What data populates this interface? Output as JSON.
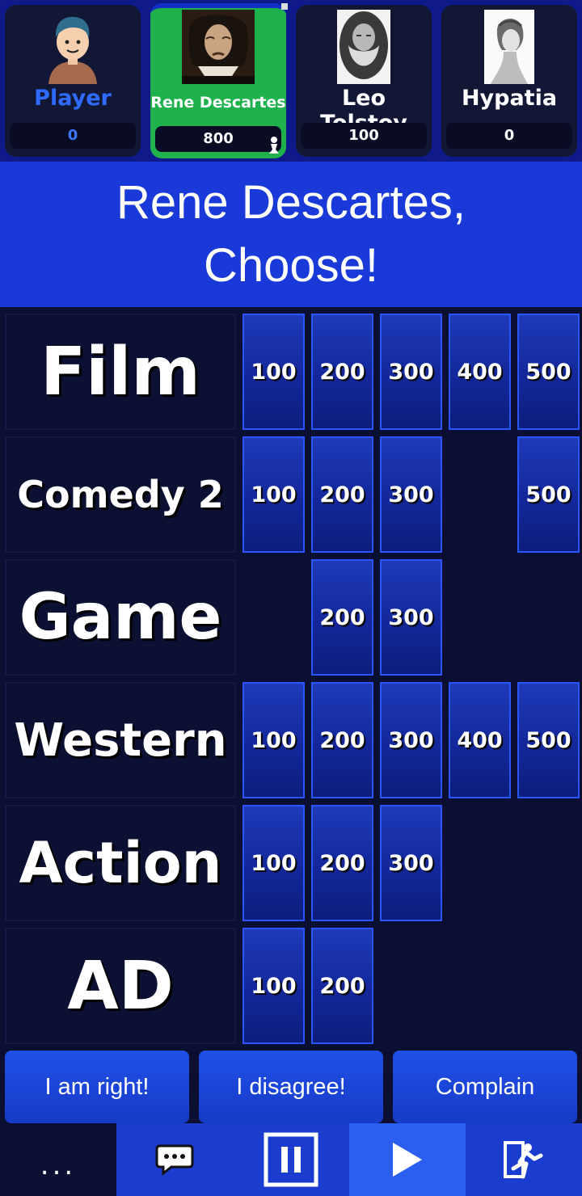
{
  "players": [
    {
      "name": "Player",
      "score": "0",
      "active": false,
      "avatar": "cartoon-person-icon"
    },
    {
      "name": "Rene Descartes",
      "score": "800",
      "active": true,
      "avatar": "descartes-portrait"
    },
    {
      "name": "Leo Tolstoy",
      "score": "100",
      "active": false,
      "avatar": "tolstoy-portrait"
    },
    {
      "name": "Hypatia",
      "score": "0",
      "active": false,
      "avatar": "hypatia-portrait"
    }
  ],
  "banner": {
    "line1": "Rene Descartes,",
    "line2": "Choose!"
  },
  "board": [
    {
      "category": "Film",
      "cells": [
        "100",
        "200",
        "300",
        "400",
        "500"
      ]
    },
    {
      "category": "Comedy 2",
      "cells": [
        "100",
        "200",
        "300",
        "",
        "500"
      ]
    },
    {
      "category": "Game",
      "cells": [
        "",
        "200",
        "300",
        "",
        ""
      ]
    },
    {
      "category": "Western",
      "cells": [
        "100",
        "200",
        "300",
        "400",
        "500"
      ]
    },
    {
      "category": "Action",
      "cells": [
        "100",
        "200",
        "300",
        "",
        ""
      ]
    },
    {
      "category": "AD",
      "cells": [
        "100",
        "200",
        "",
        "",
        ""
      ]
    }
  ],
  "actions": {
    "right": "I am right!",
    "disagree": "I disagree!",
    "complain": "Complain"
  },
  "toolbar": {
    "more": "...",
    "chat_icon": "chat-bubble-icon",
    "pause_icon": "pause-icon",
    "play_icon": "play-icon",
    "exit_icon": "exit-door-icon"
  },
  "colors": {
    "banner": "#1939d8",
    "board_bg": "#0b1033",
    "active_player": "#1fb24c",
    "cell_border": "#2a56ff"
  }
}
